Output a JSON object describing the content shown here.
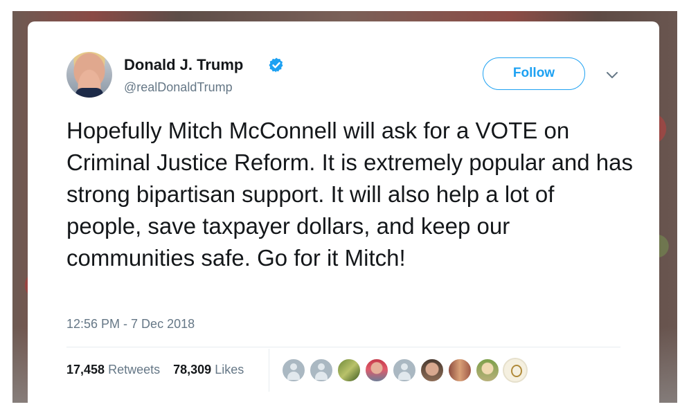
{
  "tweet": {
    "author_name": "Donald J. Trump",
    "handle": "@realDonaldTrump",
    "verified": true,
    "follow_label": "Follow",
    "caret_icon": "chevron-down-icon",
    "text": "Hopefully Mitch McConnell will ask for a VOTE on Criminal Justice Reform. It is extremely popular and has strong bipartisan support. It will also help a lot of people, save taxpayer dollars, and keep our communities safe. Go for it Mitch!",
    "timestamp": "12:56 PM - 7 Dec 2018",
    "retweets_count": "17,458",
    "retweets_label": "Retweets",
    "likes_count": "78,309",
    "likes_label": "Likes"
  },
  "colors": {
    "accent": "#1da1f2",
    "text": "#14171a",
    "secondary_text": "#657786"
  }
}
